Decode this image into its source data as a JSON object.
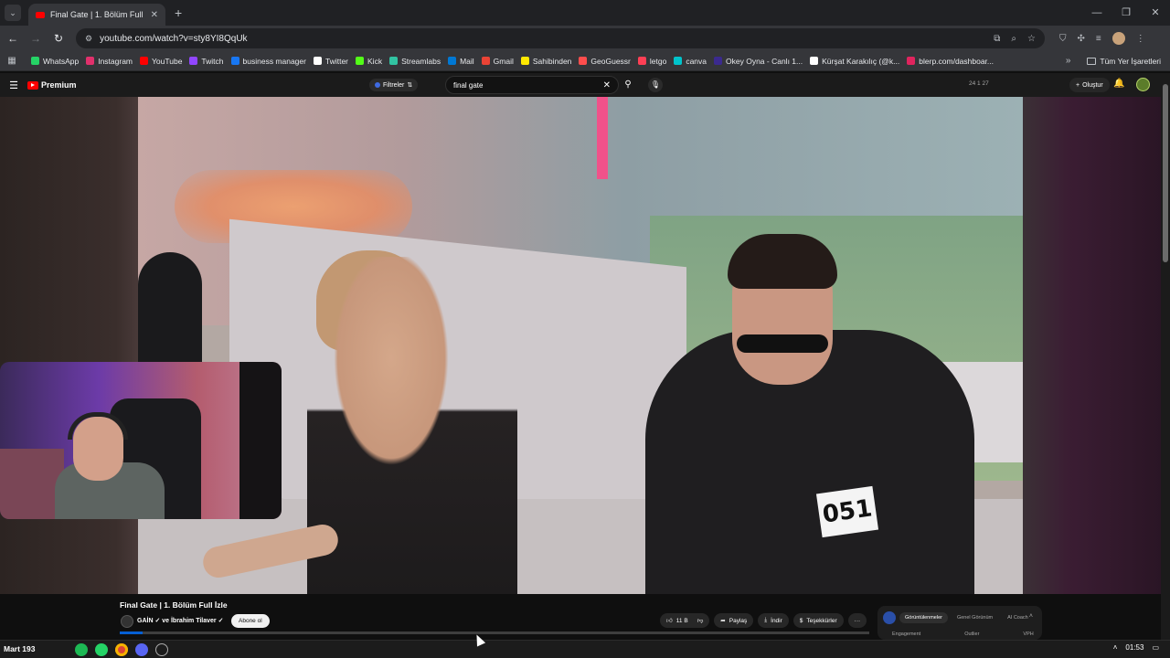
{
  "browser": {
    "tab_title": "Final Gate | 1. Bölüm Full İzle",
    "url": "youtube.com/watch?v=sty8YI8QqUk",
    "bookmarks": [
      {
        "label": "WhatsApp",
        "color": "#25d366"
      },
      {
        "label": "Instagram",
        "color": "#e1306c"
      },
      {
        "label": "YouTube",
        "color": "#ff0000"
      },
      {
        "label": "Twitch",
        "color": "#9146ff"
      },
      {
        "label": "business manager",
        "color": "#1877f2"
      },
      {
        "label": "Twitter",
        "color": "#ffffff"
      },
      {
        "label": "Kick",
        "color": "#53fc18"
      },
      {
        "label": "Streamlabs",
        "color": "#31c3a2"
      },
      {
        "label": "Mail",
        "color": "#0078d4"
      },
      {
        "label": "Gmail",
        "color": "#ea4335"
      },
      {
        "label": "Sahibinden",
        "color": "#ffe800"
      },
      {
        "label": "GeoGuessr",
        "color": "#ff4d4d"
      },
      {
        "label": "letgo",
        "color": "#ff3f55"
      },
      {
        "label": "canva",
        "color": "#00c4cc"
      },
      {
        "label": "Okey Oyna - Canlı 1...",
        "color": "#3b2a8f"
      },
      {
        "label": "Kürşat Karakılıç (@k...",
        "color": "#ffffff"
      },
      {
        "label": "blerp.com/dashboar...",
        "color": "#e0245e"
      }
    ],
    "bookmarks_more": "»",
    "bookmarks_folder": "Tüm Yer İşaretleri"
  },
  "youtube": {
    "logo": "Premium",
    "filters": "Filtreler",
    "search_query": "final gate",
    "stats": "24  1  27",
    "create_label": "Oluştur",
    "video_title": "Final Gate | 1. Bölüm Full İzle",
    "channel": "GAİN ✓ ve İbrahim Tilaver ✓",
    "subscribe": "Abone ol",
    "bib_number": "051",
    "likes": "11 B",
    "share": "Paylaş",
    "download": "İndir",
    "thanks": "Teşekkürler",
    "more": "···",
    "progress": 0.03
  },
  "extension": {
    "tabs": [
      "Görüntülenmeler",
      "Genel Görünüm",
      "AI Coach"
    ],
    "columns": [
      "Engagement",
      "Outlier",
      "VPH"
    ]
  },
  "taskbar": {
    "weather": "Mart 193",
    "time": "01:53"
  }
}
